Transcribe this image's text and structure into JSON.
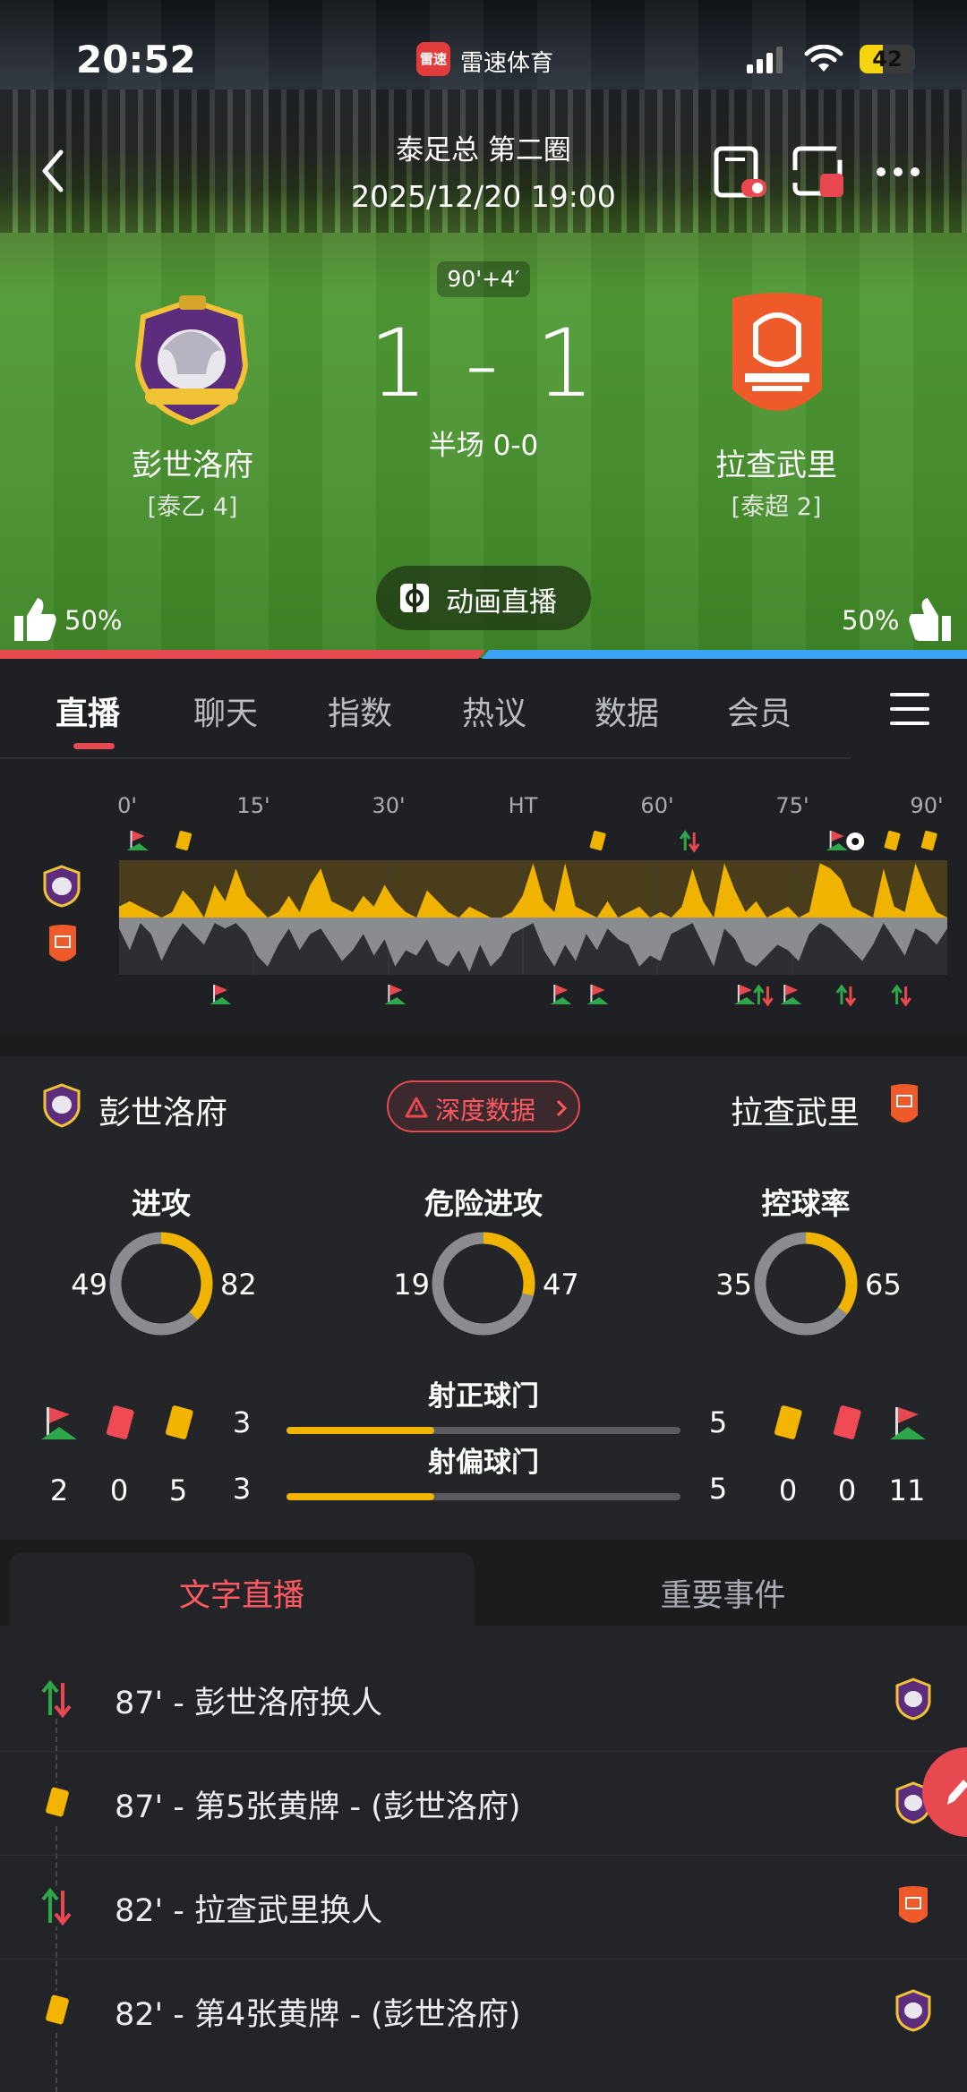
{
  "status_bar": {
    "time": "20:52",
    "app_badge": "雷速",
    "app_name": "雷速体育",
    "battery": "42",
    "battery_level": 0.42
  },
  "header": {
    "competition": "泰足总 第二圈",
    "datetime": "2025/12/20 19:00",
    "back_icon": "chevron-left-icon",
    "actions": [
      "float-window-icon",
      "picture-in-picture-icon",
      "more-icon"
    ]
  },
  "match": {
    "minute": "90'+4′",
    "score": "1 - 1",
    "halftime": "半场 0-0",
    "home": {
      "name": "彭世洛府",
      "league": "[泰乙 4]",
      "vote": "50%",
      "color": "#e8484f"
    },
    "away": {
      "name": "拉查武里",
      "league": "[泰超 2]",
      "vote": "50%",
      "color": "#3aa3f5"
    },
    "live_button": "动画直播"
  },
  "tabs": {
    "items": [
      "直播",
      "聊天",
      "指数",
      "热议",
      "数据",
      "会员"
    ],
    "active": 0
  },
  "timeline": {
    "ticks": [
      "0'",
      "15'",
      "30'",
      "HT",
      "60'",
      "75'",
      "90'"
    ],
    "home_momentum": [
      0.2,
      0.3,
      0.2,
      0.1,
      0.0,
      0.1,
      0.5,
      0.3,
      0.0,
      0.6,
      0.3,
      0.9,
      0.4,
      0.2,
      0.0,
      0.1,
      0.4,
      0.1,
      0.6,
      0.9,
      0.3,
      0.2,
      0.1,
      0.4,
      0.2,
      0.6,
      0.3,
      0.1,
      0.0,
      0.5,
      0.3,
      0.1,
      0.0,
      0.2,
      0.1,
      0.0,
      0.0,
      0.1,
      0.4,
      1.0,
      0.3,
      0.1,
      1.0,
      0.2,
      0.1,
      0.0,
      0.3,
      0.0,
      0.1,
      0.2,
      0.0,
      0.1,
      0.0,
      0.2,
      0.9,
      0.3,
      0.0,
      1.0,
      0.5,
      0.1,
      0.3,
      0.0,
      0.1,
      0.2,
      0.0,
      0.1,
      1.0,
      0.9,
      0.7,
      0.2,
      0.1,
      0.0,
      0.9,
      0.2,
      0.1,
      1.0,
      0.5,
      0.1,
      0.0
    ],
    "away_momentum": [
      0.2,
      0.6,
      0.1,
      0.3,
      0.8,
      0.4,
      0.1,
      0.3,
      0.5,
      0.1,
      0.2,
      0.1,
      0.3,
      0.7,
      0.9,
      0.5,
      0.2,
      0.6,
      0.3,
      0.2,
      0.5,
      0.8,
      0.6,
      0.3,
      0.7,
      0.4,
      0.9,
      0.6,
      0.7,
      0.4,
      0.8,
      0.9,
      0.6,
      1.0,
      0.5,
      0.9,
      0.7,
      0.3,
      0.2,
      0.1,
      0.6,
      0.9,
      0.5,
      0.8,
      0.3,
      0.6,
      0.2,
      0.4,
      0.5,
      0.9,
      0.7,
      0.8,
      0.3,
      0.2,
      0.1,
      0.5,
      0.9,
      0.2,
      0.4,
      0.8,
      0.9,
      0.7,
      0.5,
      0.6,
      0.8,
      0.3,
      0.1,
      0.2,
      0.4,
      0.6,
      0.8,
      0.5,
      0.1,
      0.4,
      0.7,
      0.2,
      0.3,
      0.5,
      0.2
    ],
    "home_events": [
      {
        "minute": 2,
        "type": "corner"
      },
      {
        "minute": 7,
        "type": "yellow"
      },
      {
        "minute": 52,
        "type": "yellow"
      },
      {
        "minute": 62,
        "type": "sub"
      },
      {
        "minute": 78,
        "type": "corner"
      },
      {
        "minute": 80,
        "type": "goal"
      },
      {
        "minute": 84,
        "type": "yellow"
      },
      {
        "minute": 88,
        "type": "yellow"
      }
    ],
    "away_events": [
      {
        "minute": 11,
        "type": "corner"
      },
      {
        "minute": 30,
        "type": "corner"
      },
      {
        "minute": 48,
        "type": "corner"
      },
      {
        "minute": 52,
        "type": "corner"
      },
      {
        "minute": 68,
        "type": "corner"
      },
      {
        "minute": 70,
        "type": "sub"
      },
      {
        "minute": 73,
        "type": "corner"
      },
      {
        "minute": 79,
        "type": "sub"
      },
      {
        "minute": 85,
        "type": "sub"
      }
    ]
  },
  "stats": {
    "home_name": "彭世洛府",
    "away_name": "拉查武里",
    "deep_data": "深度数据",
    "donuts": [
      {
        "label": "进攻",
        "home": "49",
        "away": "82"
      },
      {
        "label": "危险进攻",
        "home": "19",
        "away": "47"
      },
      {
        "label": "控球率",
        "home": "35",
        "away": "65"
      }
    ],
    "bars": [
      {
        "label": "射正球门",
        "home": "3",
        "away": "5"
      },
      {
        "label": "射偏球门",
        "home": "3",
        "away": "5"
      }
    ],
    "home_counts": {
      "corners": "2",
      "red": "0",
      "yellow": "5"
    },
    "away_counts": {
      "yellow": "0",
      "red": "0",
      "corners": "11"
    }
  },
  "feed": {
    "tabs": [
      "文字直播",
      "重要事件"
    ],
    "active": 0,
    "events": [
      {
        "icon": "substitution-icon",
        "text": "87' - 彭世洛府换人",
        "team": "home"
      },
      {
        "icon": "yellow-card-icon",
        "text": "87' - 第5张黄牌 - (彭世洛府)",
        "team": "home"
      },
      {
        "icon": "substitution-icon",
        "text": "82' - 拉查武里换人",
        "team": "away"
      },
      {
        "icon": "yellow-card-icon",
        "text": "82' - 第4张黄牌 - (彭世洛府)",
        "team": "home"
      }
    ]
  },
  "colors": {
    "accent": "#e8484f",
    "yellow": "#f0b400",
    "grey": "#8a8c90",
    "blue": "#3aa3f5"
  }
}
